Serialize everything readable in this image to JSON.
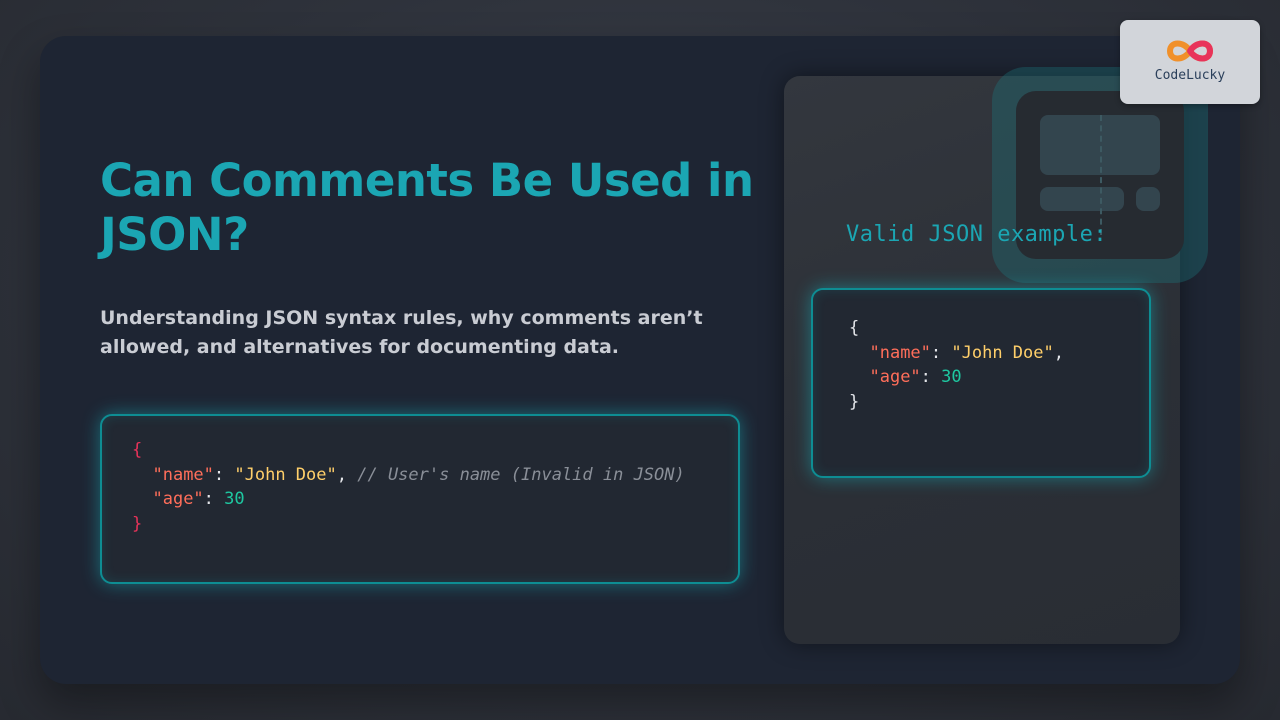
{
  "title": "Can Comments Be Used in JSON?",
  "subtitle": "Understanding JSON syntax rules, why comments aren’t allowed, and alternatives for documenting data.",
  "invalid_code": {
    "open": "{",
    "name_key": "\"name\"",
    "name_value": "\"John Doe\"",
    "comment": "// User's name (Invalid in JSON)",
    "age_key": "\"age\"",
    "age_value": "30",
    "close": "}"
  },
  "valid_example": {
    "label": "Valid JSON example:",
    "open": "{",
    "name_key": "\"name\"",
    "name_value": "\"John Doe\"",
    "age_key": "\"age\"",
    "age_value": "30",
    "close": "}"
  },
  "logo": {
    "text": "CodeLucky",
    "icon": "infinity-logo-icon"
  },
  "colors": {
    "accent": "#1ba6b3",
    "key": "#ff6e5a",
    "string": "#ffcf6a",
    "number": "#1ec7a0",
    "brace": "#e8335a",
    "comment": "#8a8f98"
  }
}
